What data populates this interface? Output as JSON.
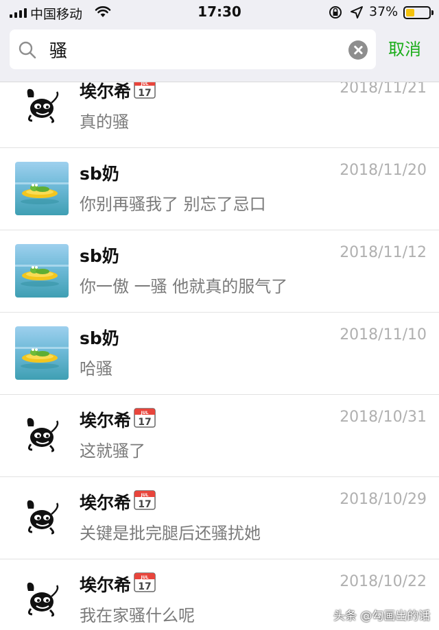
{
  "status_bar": {
    "carrier": "中国移动",
    "time": "17:30",
    "battery_percent": "37%",
    "battery_level": 0.37,
    "battery_color": "#f4c20d",
    "icons": [
      "signal-icon",
      "wifi-icon",
      "orientation-lock-icon",
      "location-icon",
      "battery-icon"
    ]
  },
  "search": {
    "query": "骚",
    "cancel_label": "取消",
    "accent_color": "#1aad19"
  },
  "results": [
    {
      "name": "埃尔希",
      "has_calendar_emoji": true,
      "avatar": "cartoon",
      "date": "2018/11/21",
      "snippet": "真的骚"
    },
    {
      "name": "sb奶",
      "has_calendar_emoji": false,
      "avatar": "frog-photo",
      "date": "2018/11/20",
      "snippet": "你别再骚我了 别忘了忌口"
    },
    {
      "name": "sb奶",
      "has_calendar_emoji": false,
      "avatar": "frog-photo",
      "date": "2018/11/12",
      "snippet": "你一傲 一骚 他就真的服气了"
    },
    {
      "name": "sb奶",
      "has_calendar_emoji": false,
      "avatar": "frog-photo",
      "date": "2018/11/10",
      "snippet": "哈骚"
    },
    {
      "name": "埃尔希",
      "has_calendar_emoji": true,
      "avatar": "cartoon",
      "date": "2018/10/31",
      "snippet": "这就骚了"
    },
    {
      "name": "埃尔希",
      "has_calendar_emoji": true,
      "avatar": "cartoon",
      "date": "2018/10/29",
      "snippet": "关键是批完腿后还骚扰她"
    },
    {
      "name": "埃尔希",
      "has_calendar_emoji": true,
      "avatar": "cartoon",
      "date": "2018/10/22",
      "snippet": "我在家骚什么呢"
    }
  ],
  "calendar_emoji": {
    "month": "JUL",
    "day": "17"
  },
  "watermark": "头条 @勾画出的话"
}
